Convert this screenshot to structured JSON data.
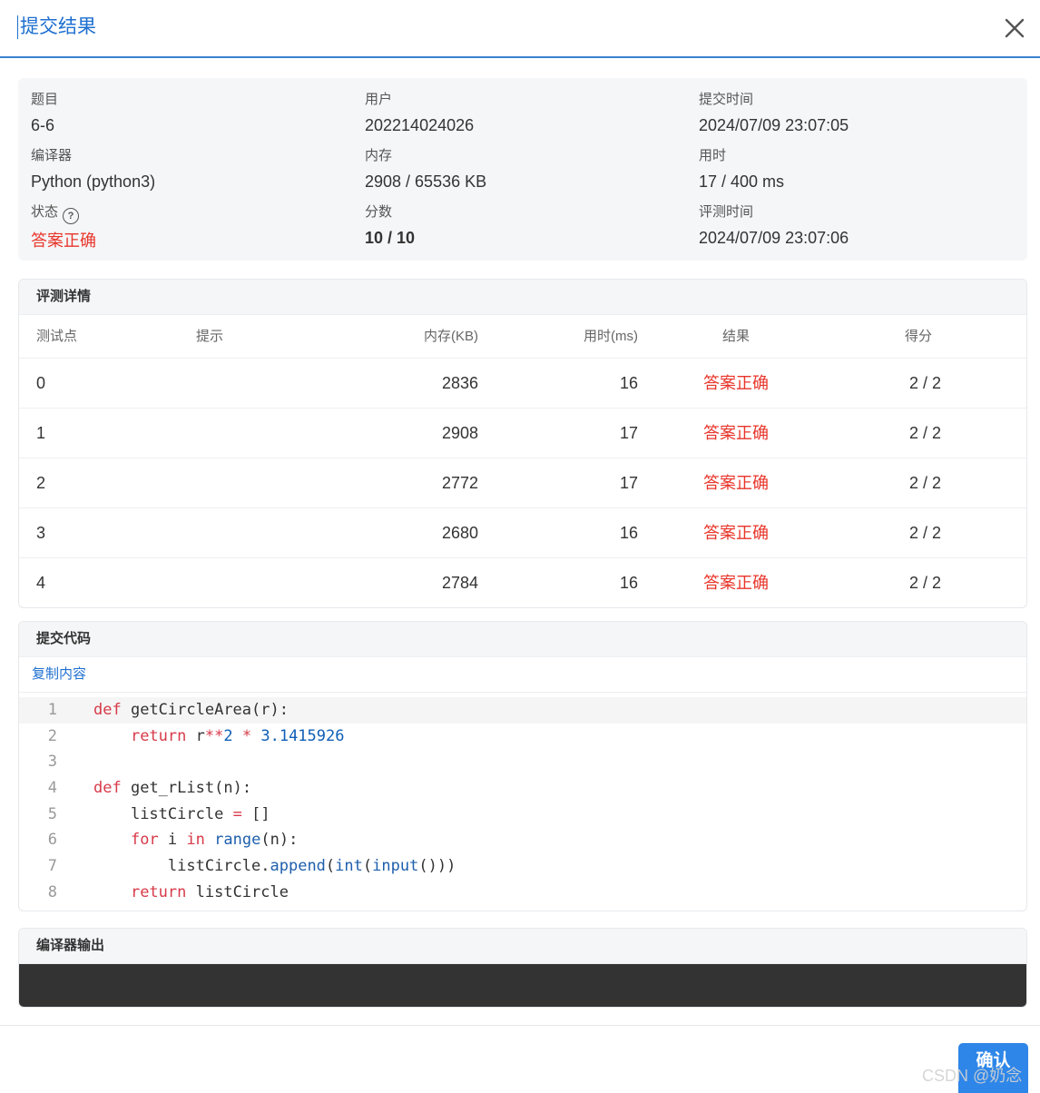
{
  "header": {
    "title": "提交结果",
    "close_icon": "close-icon"
  },
  "info": {
    "problem_label": "题目",
    "problem": "6-6",
    "user_label": "用户",
    "user": "202214024026",
    "submit_time_label": "提交时间",
    "submit_time": "2024/07/09 23:07:05",
    "compiler_label": "编译器",
    "compiler": "Python (python3)",
    "memory_label": "内存",
    "memory": "2908 / 65536 KB",
    "time_label": "用时",
    "time": "17 / 400 ms",
    "status_label": "状态",
    "status_help": "?",
    "status": "答案正确",
    "score_label": "分数",
    "score": "10 / 10",
    "judge_time_label": "评测时间",
    "judge_time": "2024/07/09 23:07:06",
    "status_color": "#e8352a"
  },
  "details": {
    "title": "评测详情",
    "columns": [
      "测试点",
      "提示",
      "内存(KB)",
      "用时(ms)",
      "结果",
      "得分"
    ],
    "rows": [
      {
        "case": "0",
        "hint": "",
        "memory": "2836",
        "time": "16",
        "result": "答案正确",
        "score": "2 / 2"
      },
      {
        "case": "1",
        "hint": "",
        "memory": "2908",
        "time": "17",
        "result": "答案正确",
        "score": "2 / 2"
      },
      {
        "case": "2",
        "hint": "",
        "memory": "2772",
        "time": "17",
        "result": "答案正确",
        "score": "2 / 2"
      },
      {
        "case": "3",
        "hint": "",
        "memory": "2680",
        "time": "16",
        "result": "答案正确",
        "score": "2 / 2"
      },
      {
        "case": "4",
        "hint": "",
        "memory": "2784",
        "time": "16",
        "result": "答案正确",
        "score": "2 / 2"
      }
    ]
  },
  "code_section": {
    "title": "提交代码",
    "copy_label": "复制内容",
    "line_numbers": [
      "1",
      "2",
      "3",
      "4",
      "5",
      "6",
      "7",
      "8"
    ],
    "lines": [
      "def getCircleArea(r):",
      "    return r**2 * 3.1415926",
      "",
      "def get_rList(n):",
      "    listCircle = []",
      "    for i in range(n):",
      "        listCircle.append(int(input()))",
      "    return listCircle"
    ]
  },
  "compiler_output": {
    "title": "编译器输出",
    "text": ""
  },
  "footer": {
    "confirm_label": "确认",
    "watermark": "CSDN @奶念"
  },
  "colors": {
    "accent": "#1e6fd0",
    "success_red": "#e8352a",
    "button": "#2e86e8",
    "output_bg": "#333333"
  }
}
